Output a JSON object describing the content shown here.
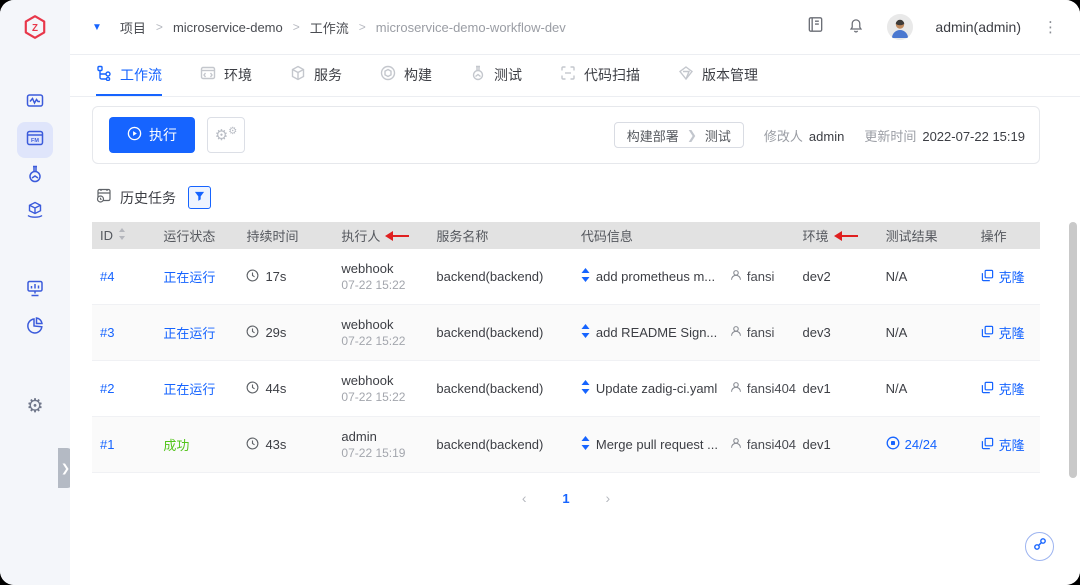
{
  "colors": {
    "accent": "#1664ff",
    "success_green": "#52c41a",
    "running_blue": "#1664ff",
    "annotation_arrow_red": "#e02020",
    "logo_red": "#e8374a"
  },
  "header": {
    "breadcrumb": {
      "items": [
        "项目",
        "microservice-demo",
        "工作流",
        "microservice-demo-workflow-dev"
      ],
      "separator": ">"
    },
    "user": "admin(admin)",
    "icons": [
      "docs-book-icon",
      "notification-bell-icon",
      "avatar",
      "more-vertical-icon"
    ]
  },
  "tabs": [
    {
      "label": "工作流",
      "active": true
    },
    {
      "label": "环境"
    },
    {
      "label": "服务"
    },
    {
      "label": "构建"
    },
    {
      "label": "测试"
    },
    {
      "label": "代码扫描"
    },
    {
      "label": "版本管理"
    }
  ],
  "toolbar": {
    "run_label": "执行",
    "stages": [
      "构建部署",
      "测试"
    ],
    "modifier_label": "修改人",
    "modifier_value": "admin",
    "updated_label": "更新时间",
    "updated_value": "2022-07-22 15:19"
  },
  "history": {
    "title": "历史任务"
  },
  "table": {
    "headers": [
      "ID",
      "运行状态",
      "持续时间",
      "执行人",
      "服务名称",
      "代码信息",
      "环境",
      "测试结果",
      "操作"
    ],
    "rows": [
      {
        "id": "#4",
        "status": "正在运行",
        "status_color": "#1664ff",
        "duration": "17s",
        "executor": "webhook",
        "executor_time": "07-22 15:22",
        "service": "backend(backend)",
        "commit": "add prometheus m...",
        "author": "fansi",
        "env": "dev2",
        "result": "N/A",
        "action": "克隆"
      },
      {
        "id": "#3",
        "status": "正在运行",
        "status_color": "#1664ff",
        "duration": "29s",
        "executor": "webhook",
        "executor_time": "07-22 15:22",
        "service": "backend(backend)",
        "commit": "add README Sign...",
        "author": "fansi",
        "env": "dev3",
        "result": "N/A",
        "action": "克隆"
      },
      {
        "id": "#2",
        "status": "正在运行",
        "status_color": "#1664ff",
        "duration": "44s",
        "executor": "webhook",
        "executor_time": "07-22 15:22",
        "service": "backend(backend)",
        "commit": "Update zadig-ci.yaml",
        "author": "fansi404",
        "env": "dev1",
        "result": "N/A",
        "action": "克隆"
      },
      {
        "id": "#1",
        "status": "成功",
        "status_color": "#52c41a",
        "duration": "43s",
        "executor": "admin",
        "executor_time": "07-22 15:19",
        "service": "backend(backend)",
        "commit": "Merge pull request ...",
        "author": "fansi404",
        "env": "dev1",
        "result": "24/24",
        "action": "克隆"
      }
    ]
  },
  "pagination": {
    "prev": "‹",
    "page": "1",
    "next": "›"
  }
}
